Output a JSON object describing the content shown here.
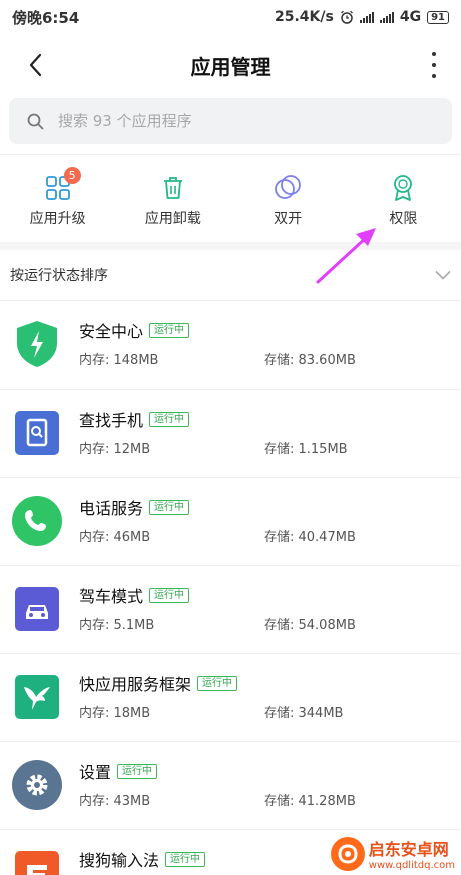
{
  "status": {
    "time": "傍晚6:54",
    "speed": "25.4K/s",
    "network": "4G",
    "battery": "91"
  },
  "header": {
    "title": "应用管理"
  },
  "search": {
    "placeholder": "搜索 93 个应用程序"
  },
  "quick_actions": [
    {
      "label": "应用升级",
      "badge": "5",
      "icon": "app-upgrade-icon"
    },
    {
      "label": "应用卸载",
      "icon": "trash-icon"
    },
    {
      "label": "双开",
      "icon": "dual-app-icon"
    },
    {
      "label": "权限",
      "icon": "permission-badge-icon"
    }
  ],
  "sort": {
    "label": "按运行状态排序"
  },
  "running_tag": "运行中",
  "apps": [
    {
      "name": "安全中心",
      "running": true,
      "memory": "内存: 148MB",
      "storage": "存储: 83.60MB",
      "icon": "security-shield-icon",
      "color": "#2bbf74"
    },
    {
      "name": "查找手机",
      "running": true,
      "memory": "内存: 12MB",
      "storage": "存储: 1.15MB",
      "icon": "find-phone-icon",
      "color": "#4a6fd4"
    },
    {
      "name": "电话服务",
      "running": true,
      "memory": "内存: 46MB",
      "storage": "存储: 40.47MB",
      "icon": "phone-icon",
      "color": "#2fc566"
    },
    {
      "name": "驾车模式",
      "running": true,
      "memory": "内存: 5.1MB",
      "storage": "存储: 54.08MB",
      "icon": "car-icon",
      "color": "#5b5bd6"
    },
    {
      "name": "快应用服务框架",
      "running": true,
      "memory": "内存: 18MB",
      "storage": "存储: 344MB",
      "icon": "hummingbird-icon",
      "color": "#1fb07f"
    },
    {
      "name": "设置",
      "running": true,
      "memory": "内存: 43MB",
      "storage": "存储: 41.28MB",
      "icon": "settings-gear-icon",
      "color": "#5a7591"
    },
    {
      "name": "搜狗输入法",
      "running": true,
      "memory": "",
      "storage": "",
      "icon": "sogou-icon",
      "color": "#f05a28"
    }
  ],
  "watermark": {
    "title": "启东安卓网",
    "url": "www.qdlitdq.com"
  },
  "colors": {
    "accent_green": "#2ea84d",
    "arrow": "#e040fb",
    "badge": "#f36a4e"
  }
}
